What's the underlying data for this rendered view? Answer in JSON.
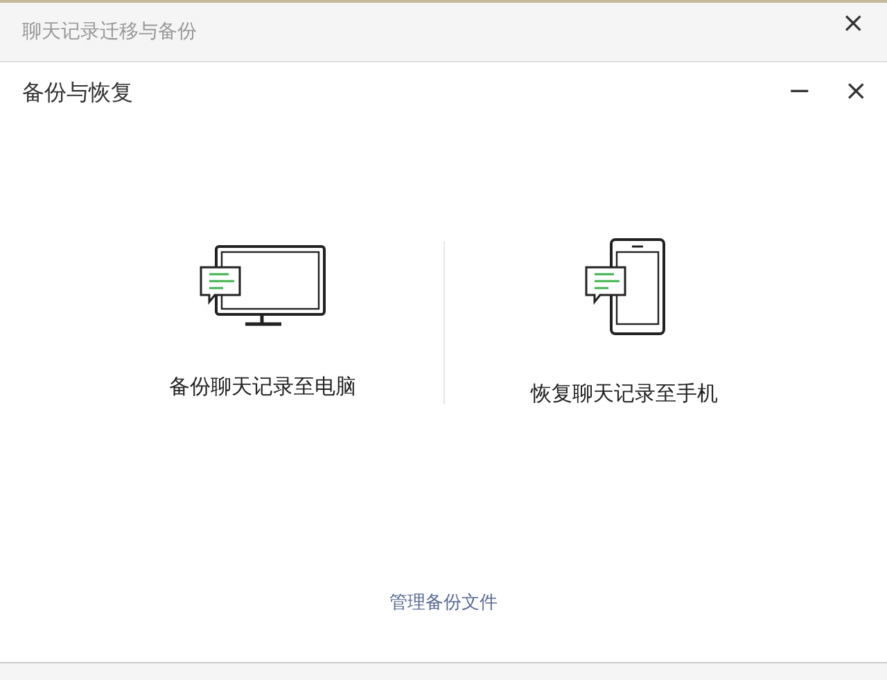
{
  "outer_window": {
    "title": "聊天记录迁移与备份",
    "close": "×"
  },
  "dialog": {
    "title": "备份与恢复",
    "minimize": "−",
    "close": "×"
  },
  "options": [
    {
      "kind": "computer",
      "label": "备份聊天记录至电脑"
    },
    {
      "kind": "phone",
      "label": "恢复聊天记录至手机"
    }
  ],
  "link": "管理备份文件"
}
